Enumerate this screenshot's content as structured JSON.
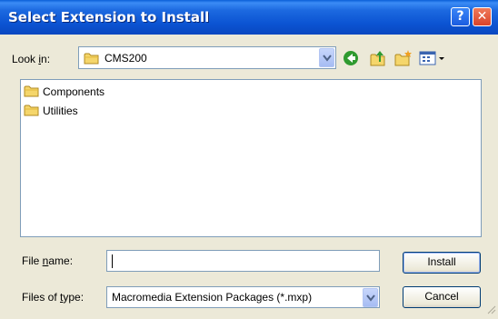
{
  "dialog": {
    "title": "Select Extension to Install",
    "help_label": "?",
    "close_label": "✕"
  },
  "lookin": {
    "label_pre": "Look ",
    "label_key": "i",
    "label_post": "n:",
    "value": "CMS200"
  },
  "toolbar": {
    "icons": [
      "back-icon",
      "up-folder-icon",
      "new-folder-icon",
      "views-menu-icon"
    ]
  },
  "files": [
    {
      "name": "Components",
      "icon": "folder-icon"
    },
    {
      "name": "Utilities",
      "icon": "folder-icon"
    }
  ],
  "filename": {
    "label_pre": "File ",
    "label_key": "n",
    "label_post": "ame:",
    "value": ""
  },
  "filetype": {
    "label_pre": "Files of ",
    "label_key": "t",
    "label_post": "ype:",
    "value": "Macromedia Extension Packages (*.mxp)"
  },
  "buttons": {
    "install": "Install",
    "cancel": "Cancel"
  },
  "colors": {
    "titlebar": "#0b53d2",
    "dialog_bg": "#ece9d8",
    "close": "#d9432a"
  }
}
